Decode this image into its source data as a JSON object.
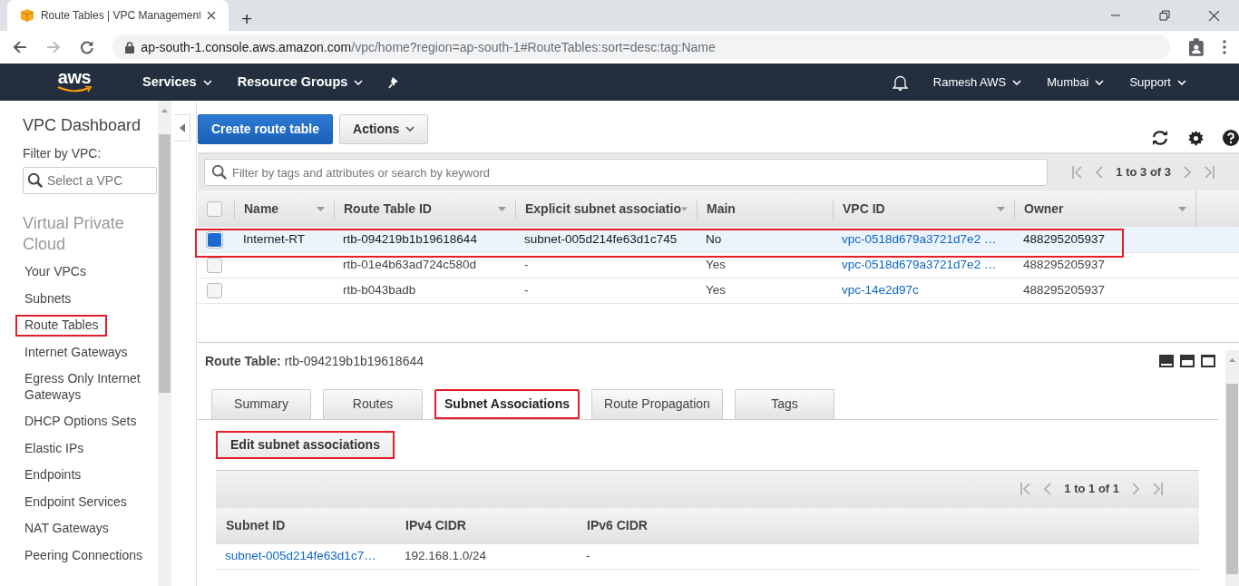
{
  "browser": {
    "tab_title": "Route Tables | VPC Management",
    "new_tab": "+",
    "url_host": "ap-south-1.console.aws.amazon.com",
    "url_path": "/vpc/home?region=ap-south-1#RouteTables:sort=desc:tag:Name"
  },
  "top_nav": {
    "logo": "aws",
    "left": [
      {
        "label": "Services"
      },
      {
        "label": "Resource Groups"
      }
    ],
    "right": [
      {
        "label": "Ramesh AWS"
      },
      {
        "label": "Mumbai"
      },
      {
        "label": "Support"
      }
    ]
  },
  "sidebar": {
    "title": "VPC Dashboard",
    "filter_label": "Filter by VPC:",
    "filter": {
      "placeholder": "Select a VPC"
    },
    "section": "Virtual Private Cloud",
    "items": [
      {
        "label": "Your VPCs",
        "highlighted": false
      },
      {
        "label": "Subnets",
        "highlighted": false
      },
      {
        "label": "Route Tables",
        "highlighted": true
      },
      {
        "label": "Internet Gateways",
        "highlighted": false
      },
      {
        "label": "Egress Only Internet Gateways",
        "highlighted": false
      },
      {
        "label": "DHCP Options Sets",
        "highlighted": false
      },
      {
        "label": "Elastic IPs",
        "highlighted": false
      },
      {
        "label": "Endpoints",
        "highlighted": false
      },
      {
        "label": "Endpoint Services",
        "highlighted": false
      },
      {
        "label": "NAT Gateways",
        "highlighted": false
      },
      {
        "label": "Peering Connections",
        "highlighted": false
      }
    ]
  },
  "toolbar": {
    "buttons": [
      {
        "label": "Create route table",
        "kind": "primary"
      },
      {
        "label": "Actions",
        "kind": "dropdown"
      }
    ]
  },
  "table": {
    "search": {
      "placeholder": "Filter by tags and attributes or search by keyword"
    },
    "pagination": "1 to 3 of 3",
    "select_all": {
      "checked": false
    },
    "columns": [
      "Name",
      "Route Table ID",
      "Explicit subnet associatio",
      "Main",
      "VPC ID",
      "Owner"
    ],
    "rows": [
      {
        "selected": true,
        "highlighted": true,
        "cells": [
          "Internet-RT",
          "rtb-094219b1b19618644",
          "subnet-005d214fe63d1c745",
          "No",
          "vpc-0518d679a3721d7e2 …",
          "488295205937"
        ]
      },
      {
        "selected": false,
        "highlighted": false,
        "cells": [
          "",
          "rtb-01e4b63ad724c580d",
          "-",
          "Yes",
          "vpc-0518d679a3721d7e2 …",
          "488295205937"
        ]
      },
      {
        "selected": false,
        "highlighted": false,
        "cells": [
          "",
          "rtb-b043badb",
          "-",
          "Yes",
          "vpc-14e2d97c",
          "488295205937"
        ]
      }
    ]
  },
  "details": {
    "label": "Route Table:",
    "value": "rtb-094219b1b19618644",
    "tabs": [
      {
        "label": "Summary",
        "selected": false,
        "highlighted": false
      },
      {
        "label": "Routes",
        "selected": false,
        "highlighted": false
      },
      {
        "label": "Subnet Associations",
        "selected": true,
        "highlighted": true
      },
      {
        "label": "Route Propagation",
        "selected": false,
        "highlighted": false
      },
      {
        "label": "Tags",
        "selected": false,
        "highlighted": false
      }
    ],
    "action": {
      "label": "Edit subnet associations",
      "highlighted": true
    },
    "pagination": "1 to 1 of 1",
    "columns": [
      "Subnet ID",
      "IPv4 CIDR",
      "IPv6 CIDR"
    ],
    "rows": [
      [
        "subnet-005d214fe63d1c7…",
        "192.168.1.0/24",
        "-"
      ]
    ]
  }
}
